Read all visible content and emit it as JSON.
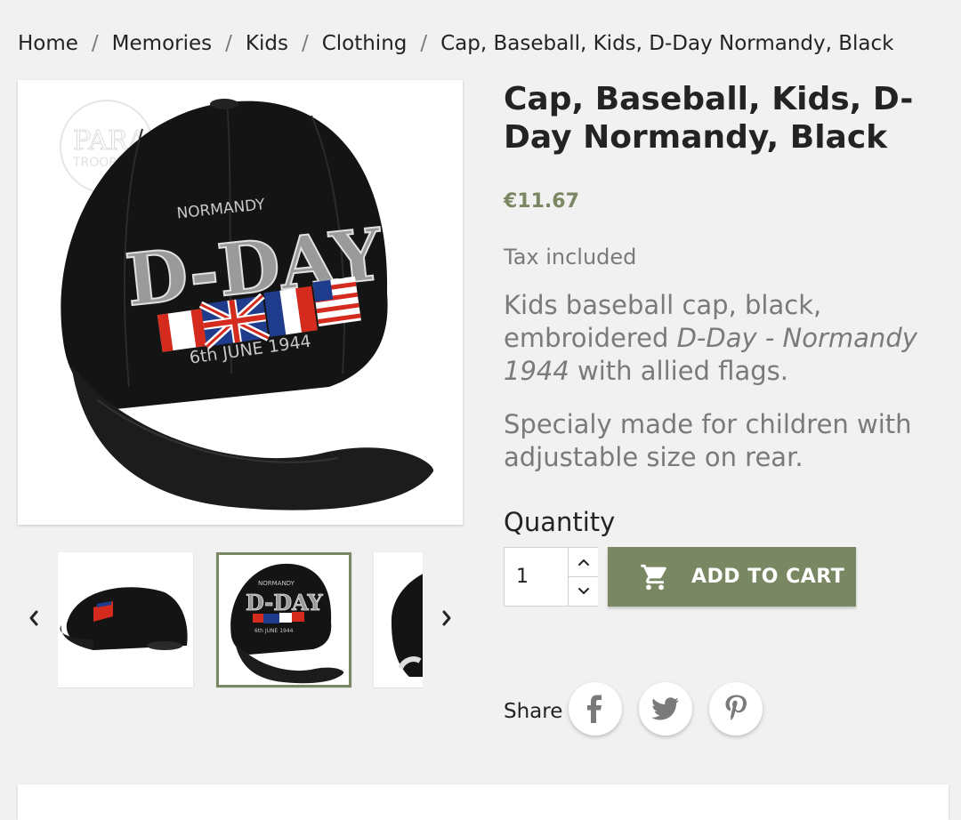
{
  "breadcrumb": {
    "items": [
      "Home",
      "Memories",
      "Kids",
      "Clothing",
      "Cap, Baseball, Kids, D-Day Normandy, Black"
    ],
    "separator": "/"
  },
  "product": {
    "title": "Cap, Baseball, Kids, D-Day Normandy, Black",
    "price": "€11.67",
    "tax_note": "Tax included",
    "description_1_before": "Kids baseball cap, black, embroidered ",
    "description_1_emphasis": "D-Day - Normandy 1944",
    "description_1_after": " with allied flags.",
    "description_2": "Specialy made for children with adjustable size on rear."
  },
  "main_image": {
    "watermark_line1": "PARA",
    "watermark_line2": "TROOPER",
    "embroidery_top": "NORMANDY",
    "embroidery_main": "D-DAY",
    "embroidery_bottom": "6th JUNE 1944"
  },
  "thumbnails": {
    "count_visible": 3,
    "selected_index": 1
  },
  "purchase": {
    "quantity_label": "Quantity",
    "quantity_value": "1",
    "add_to_cart_label": "ADD TO CART"
  },
  "share": {
    "label": "Share",
    "networks": [
      "facebook",
      "twitter",
      "pinterest"
    ]
  },
  "colors": {
    "accent": "#7a8763",
    "background": "#f1f1f1",
    "text": "#232323",
    "muted": "#7a7a7a"
  },
  "icons": [
    "chevron-left-icon",
    "chevron-right-icon",
    "chevron-up-icon",
    "chevron-down-icon",
    "cart-icon",
    "facebook-icon",
    "twitter-icon",
    "pinterest-icon"
  ]
}
